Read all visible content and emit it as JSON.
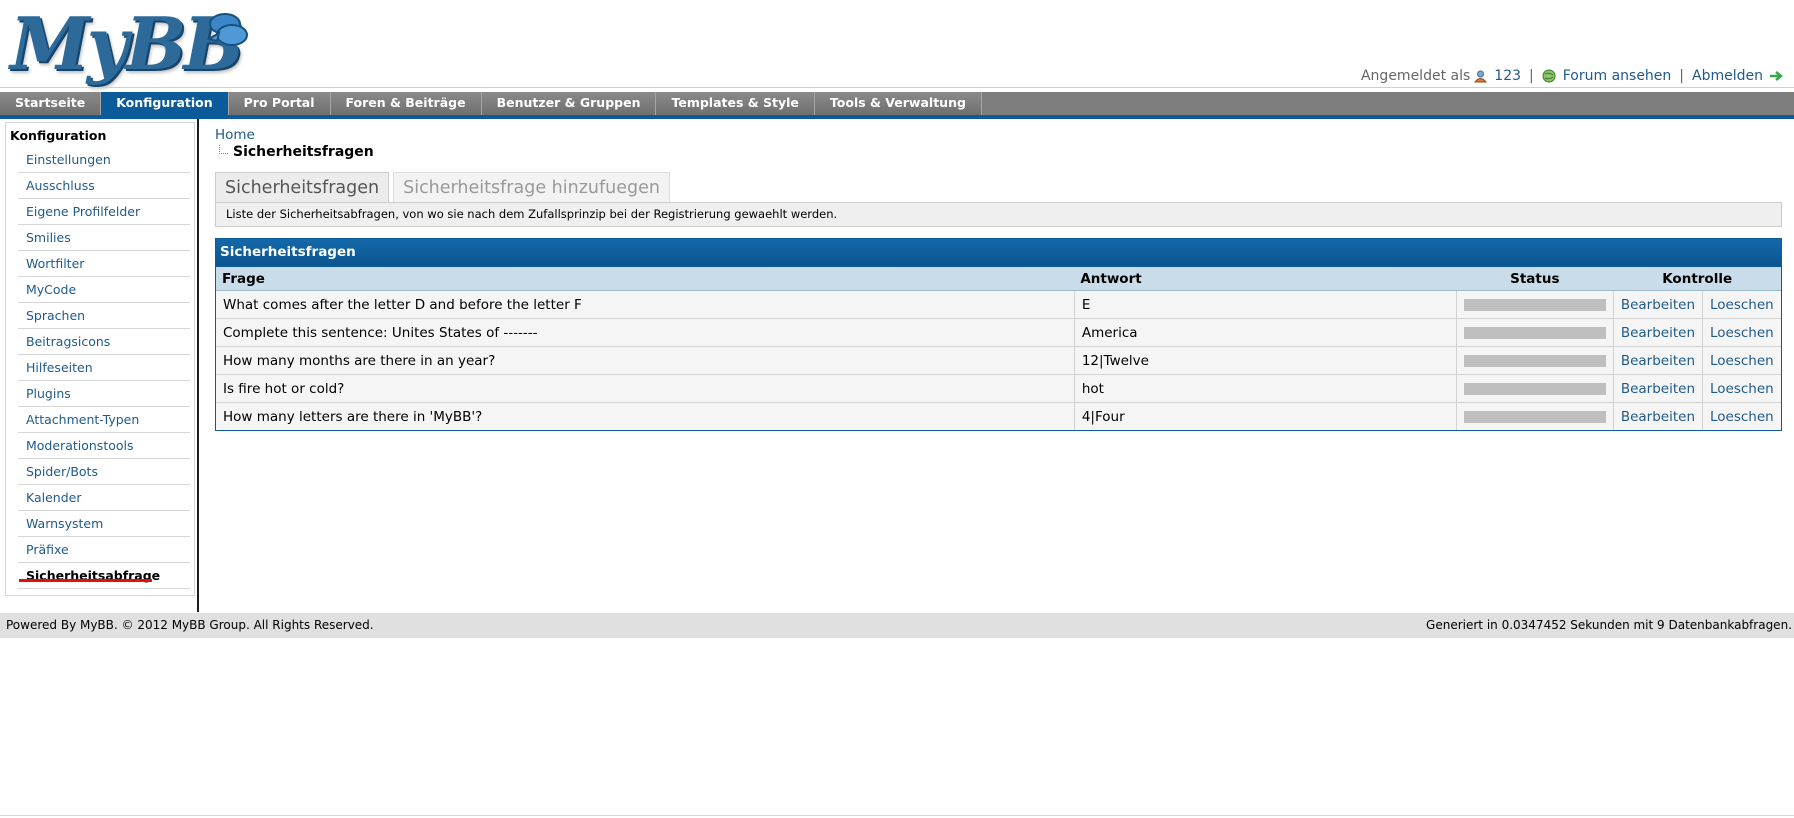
{
  "logo": {
    "text": "MyBB"
  },
  "user_bar": {
    "logged_in_label": "Angemeldet als",
    "username": "123",
    "view_forum": "Forum ansehen",
    "logout": "Abmelden"
  },
  "menu": {
    "tabs": [
      {
        "label": "Startseite",
        "active": false
      },
      {
        "label": "Konfiguration",
        "active": true
      },
      {
        "label": "Pro Portal",
        "active": false
      },
      {
        "label": "Foren & Beiträge",
        "active": false
      },
      {
        "label": "Benutzer & Gruppen",
        "active": false
      },
      {
        "label": "Templates & Style",
        "active": false
      },
      {
        "label": "Tools & Verwaltung",
        "active": false
      }
    ]
  },
  "sidebar": {
    "title": "Konfiguration",
    "items": [
      {
        "label": "Einstellungen",
        "active": false
      },
      {
        "label": "Ausschluss",
        "active": false
      },
      {
        "label": "Eigene Profilfelder",
        "active": false
      },
      {
        "label": "Smilies",
        "active": false
      },
      {
        "label": "Wortfilter",
        "active": false
      },
      {
        "label": "MyCode",
        "active": false
      },
      {
        "label": "Sprachen",
        "active": false
      },
      {
        "label": "Beitragsicons",
        "active": false
      },
      {
        "label": "Hilfeseiten",
        "active": false
      },
      {
        "label": "Plugins",
        "active": false
      },
      {
        "label": "Attachment-Typen",
        "active": false
      },
      {
        "label": "Moderationstools",
        "active": false
      },
      {
        "label": "Spider/Bots",
        "active": false
      },
      {
        "label": "Kalender",
        "active": false
      },
      {
        "label": "Warnsystem",
        "active": false
      },
      {
        "label": "Präfixe",
        "active": false
      },
      {
        "label": "Sicherheitsabfrage",
        "active": true
      }
    ]
  },
  "breadcrumb": {
    "home": "Home",
    "current": "Sicherheitsfragen"
  },
  "tabs": {
    "list": "Sicherheitsfragen",
    "add": "Sicherheitsfrage hinzufuegen",
    "description": "Liste der Sicherheitsabfragen, von wo sie nach dem Zufallsprinzip bei der Registrierung gewaehlt werden."
  },
  "table": {
    "title": "Sicherheitsfragen",
    "headers": {
      "question": "Frage",
      "answer": "Antwort",
      "status": "Status",
      "controls": "Kontrolle"
    },
    "edit_label": "Bearbeiten",
    "delete_label": "Loeschen",
    "rows": [
      {
        "question": "What comes after the letter D and before the letter F",
        "answer": "E"
      },
      {
        "question": "Complete this sentence: Unites States of -------",
        "answer": "America"
      },
      {
        "question": "How many months are there in an year?",
        "answer": "12|Twelve"
      },
      {
        "question": "Is fire hot or cold?",
        "answer": "hot"
      },
      {
        "question": "How many letters are there in 'MyBB'?",
        "answer": "4|Four"
      }
    ]
  },
  "footer": {
    "left": "Powered By MyBB. © 2012 MyBB Group. All Rights Reserved.",
    "right": "Generiert in 0.0347452 Sekunden mit 9 Datenbankabfragen."
  },
  "colors": {
    "accent": "#0b5a9a",
    "menu_bg": "#7d7d7d",
    "link": "#1f5a8a",
    "highlight_underline": "#e01010"
  }
}
